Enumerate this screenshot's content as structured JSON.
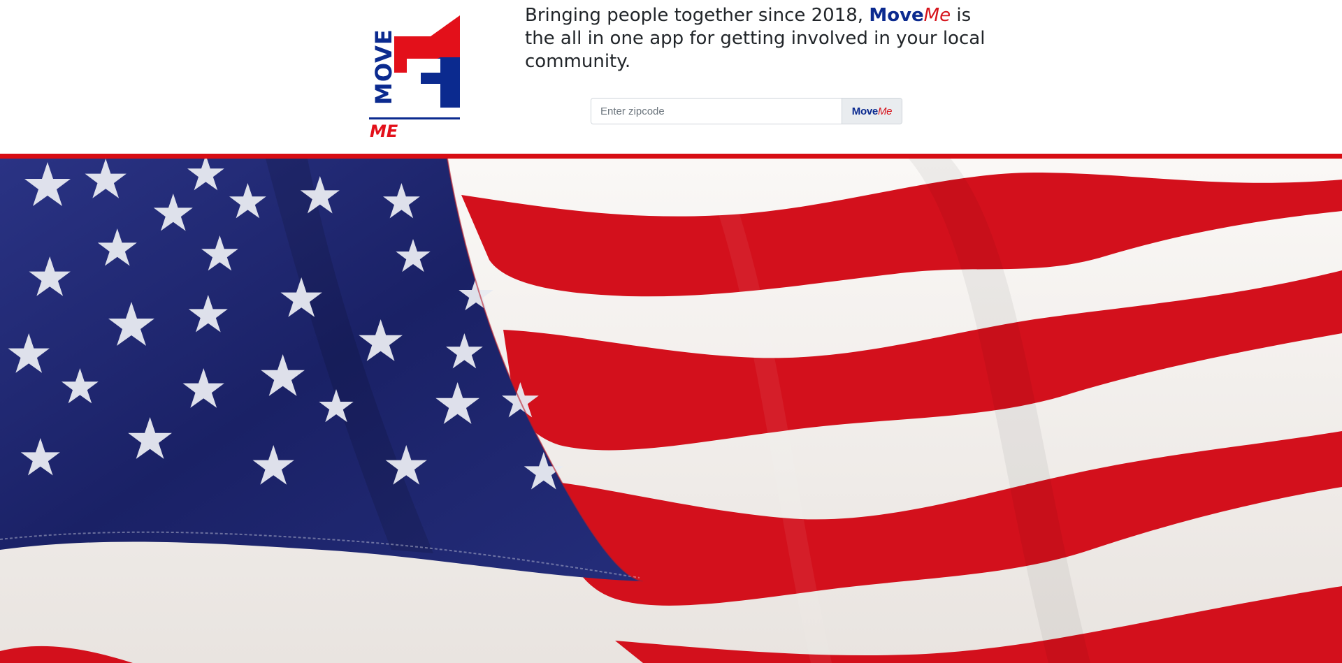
{
  "logo": {
    "vertical_text": "MOVE",
    "me_text": "ME",
    "alt": "MoveMe logo"
  },
  "tagline": {
    "prefix": "Bringing people together since 2018,",
    "brand_move": "Move",
    "brand_me": "Me",
    "suffix": "is the all in one app for getting involved in your local community."
  },
  "search": {
    "placeholder": "Enter zipcode",
    "value": "",
    "button_move": "Move",
    "button_me": "Me"
  },
  "hero": {
    "image_name": "american-flag-image"
  },
  "colors": {
    "brand_blue": "#0b2a8f",
    "brand_red": "#d6141c",
    "divider_red": "#d70d14",
    "flag_blue": "#1e2670",
    "flag_red": "#d3101c",
    "flag_white": "#f4f1ee"
  }
}
